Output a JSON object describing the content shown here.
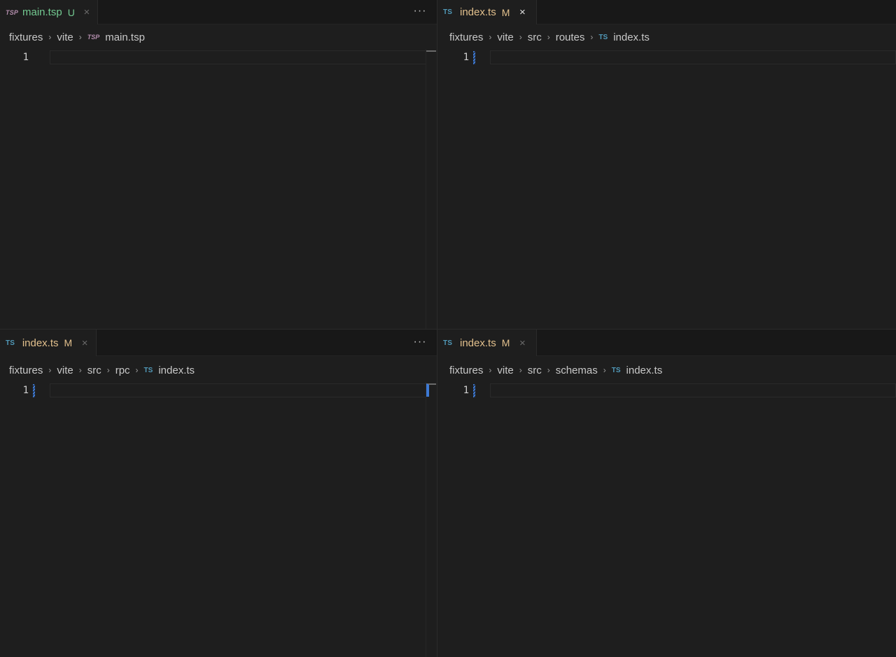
{
  "panes": [
    {
      "tab": {
        "icon_label": "TSP",
        "icon_name": "typespec-file-icon",
        "filename": "main.tsp",
        "status": "U",
        "status_color": "#73c991",
        "filename_color": "#73c991"
      },
      "breadcrumb": [
        "fixtures",
        "vite"
      ],
      "breadcrumb_file_icon": "TSP",
      "breadcrumb_file": "main.tsp",
      "line_number": "1"
    },
    {
      "tab": {
        "icon_label": "TS",
        "icon_name": "typescript-file-icon",
        "filename": "index.ts",
        "status": "M",
        "status_color": "#e2c08d",
        "filename_color": "#e2c08d"
      },
      "breadcrumb": [
        "fixtures",
        "vite",
        "src",
        "routes"
      ],
      "breadcrumb_file_icon": "TS",
      "breadcrumb_file": "index.ts",
      "line_number": "1"
    },
    {
      "tab": {
        "icon_label": "TS",
        "icon_name": "typescript-file-icon",
        "filename": "index.ts",
        "status": "M",
        "status_color": "#e2c08d",
        "filename_color": "#e2c08d"
      },
      "breadcrumb": [
        "fixtures",
        "vite",
        "src",
        "rpc"
      ],
      "breadcrumb_file_icon": "TS",
      "breadcrumb_file": "index.ts",
      "line_number": "1"
    },
    {
      "tab": {
        "icon_label": "TS",
        "icon_name": "typescript-file-icon",
        "filename": "index.ts",
        "status": "M",
        "status_color": "#e2c08d",
        "filename_color": "#e2c08d"
      },
      "breadcrumb": [
        "fixtures",
        "vite",
        "src",
        "schemas"
      ],
      "breadcrumb_file_icon": "TS",
      "breadcrumb_file": "index.ts",
      "line_number": "1"
    }
  ],
  "icons": {
    "close": "×",
    "more": "···",
    "chevron": "›"
  }
}
